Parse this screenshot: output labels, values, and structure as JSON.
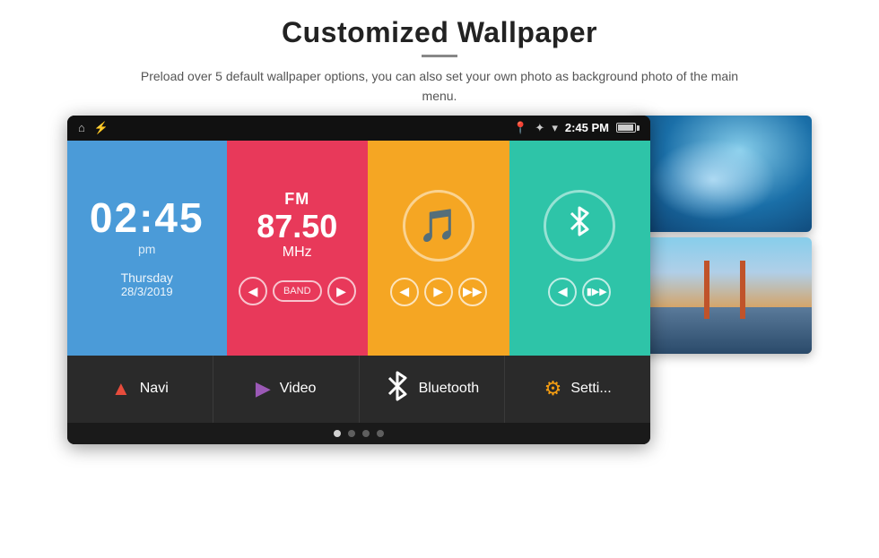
{
  "header": {
    "title": "Customized Wallpaper",
    "subtitle": "Preload over 5 default wallpaper options, you can also set your own photo as background photo of the main menu."
  },
  "status_bar": {
    "time": "2:45 PM",
    "icons": [
      "home-icon",
      "usb-icon",
      "location-icon",
      "bluetooth-icon",
      "wifi-icon",
      "battery-icon"
    ]
  },
  "clock_tile": {
    "time": "02:45",
    "ampm": "pm",
    "day": "Thursday",
    "date": "28/3/2019"
  },
  "fm_tile": {
    "label": "FM",
    "frequency": "87.50",
    "unit": "MHz"
  },
  "music_tile": {
    "icon": "🎵"
  },
  "bluetooth_tile": {
    "icon": "Bluetooth"
  },
  "bottom_nav": [
    {
      "label": "Navi",
      "icon": "navi",
      "color": "#e74c3c"
    },
    {
      "label": "Video",
      "icon": "video",
      "color": "#9b59b6"
    },
    {
      "label": "Bluetooth",
      "icon": "bluetooth",
      "color": "#3498db"
    },
    {
      "label": "Setti...",
      "icon": "settings",
      "color": "#f39c12"
    }
  ],
  "page_dots": [
    1,
    2,
    3,
    4
  ],
  "active_dot": 0
}
